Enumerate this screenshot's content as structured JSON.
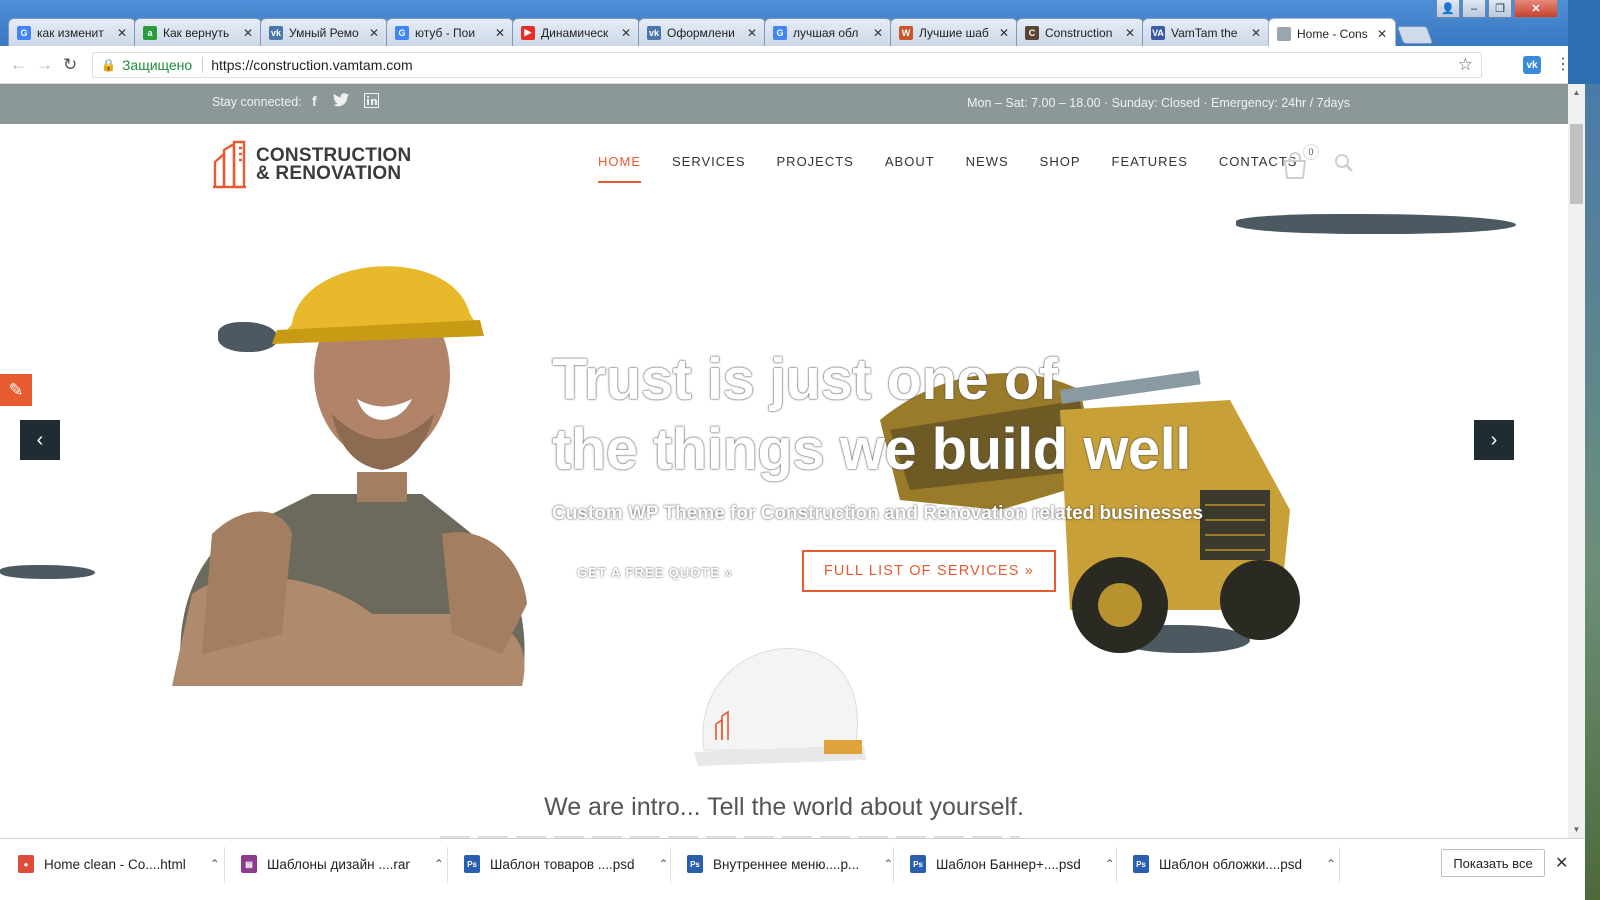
{
  "browser": {
    "tabs": [
      {
        "label": "как изменит",
        "icon": "google-icon",
        "color": "#4285f4",
        "glyph": "G"
      },
      {
        "label": "Как вернуть",
        "icon": "a-icon",
        "color": "#2a9d3b",
        "glyph": "a"
      },
      {
        "label": "Умный Ремо",
        "icon": "vk-icon",
        "color": "#4a76a8",
        "glyph": "vk"
      },
      {
        "label": "ютуб - Пои",
        "icon": "google-icon",
        "color": "#4285f4",
        "glyph": "G"
      },
      {
        "label": "Динамическ",
        "icon": "youtube-icon",
        "color": "#e52d27",
        "glyph": "▶"
      },
      {
        "label": "Оформлени",
        "icon": "vk-icon",
        "color": "#4a76a8",
        "glyph": "vk"
      },
      {
        "label": "лучшая обл",
        "icon": "google-icon",
        "color": "#4285f4",
        "glyph": "G"
      },
      {
        "label": "Лучшие шаб",
        "icon": "site-icon",
        "color": "#c9562b",
        "glyph": "W"
      },
      {
        "label": "Construction",
        "icon": "site-icon",
        "color": "#5b4536",
        "glyph": "C"
      },
      {
        "label": "VamTam the",
        "icon": "vamtam-icon",
        "color": "#3b5aa6",
        "glyph": "VA"
      },
      {
        "label": "Home - Cons",
        "icon": "page-icon",
        "color": "#9aa5b1",
        "glyph": ""
      }
    ],
    "secure_label": "Защищено",
    "url": "https://construction.vamtam.com"
  },
  "site": {
    "topbar": {
      "stay_connected": "Stay connected:",
      "hours": "Mon – Sat: 7.00 – 18.00 · Sunday: Closed · Emergency: 24hr / 7days"
    },
    "logo": {
      "line1": "CONSTRUCTION",
      "line2": "& RENOVATION"
    },
    "menu": [
      "HOME",
      "SERVICES",
      "PROJECTS",
      "ABOUT",
      "NEWS",
      "SHOP",
      "FEATURES",
      "CONTACTS"
    ],
    "cart_count": "0",
    "hero": {
      "title_line1": "Trust is just one of",
      "title_line2": "the things we build well",
      "subtitle": "Custom WP Theme for Construction and Renovation related businesses",
      "quote_button": "GET A FREE QUOTE »",
      "services_button": "FULL LIST OF SERVICES »"
    },
    "intro": "We are intro... Tell the world about yourself."
  },
  "downloads": {
    "items": [
      {
        "label": "Home clean - Co....html",
        "icon": "chrome-icon",
        "color": "#dd4b39",
        "glyph": "●"
      },
      {
        "label": "Шаблоны дизайн ....rar",
        "icon": "rar-icon",
        "color": "#8e3b8e",
        "glyph": "▤"
      },
      {
        "label": "Шаблон товаров ....psd",
        "icon": "psd-icon",
        "color": "#2a5fb0",
        "glyph": "Ps"
      },
      {
        "label": "Внутреннее меню....p...",
        "icon": "psd-icon",
        "color": "#2a5fb0",
        "glyph": "Ps"
      },
      {
        "label": "Шаблон Баннер+....psd",
        "icon": "psd-icon",
        "color": "#2a5fb0",
        "glyph": "Ps"
      },
      {
        "label": "Шаблон обложки....psd",
        "icon": "psd-icon",
        "color": "#2a5fb0",
        "glyph": "Ps"
      }
    ],
    "show_all": "Показать все"
  },
  "colors": {
    "accent": "#e65b2f",
    "topbar": "#8c9898"
  }
}
